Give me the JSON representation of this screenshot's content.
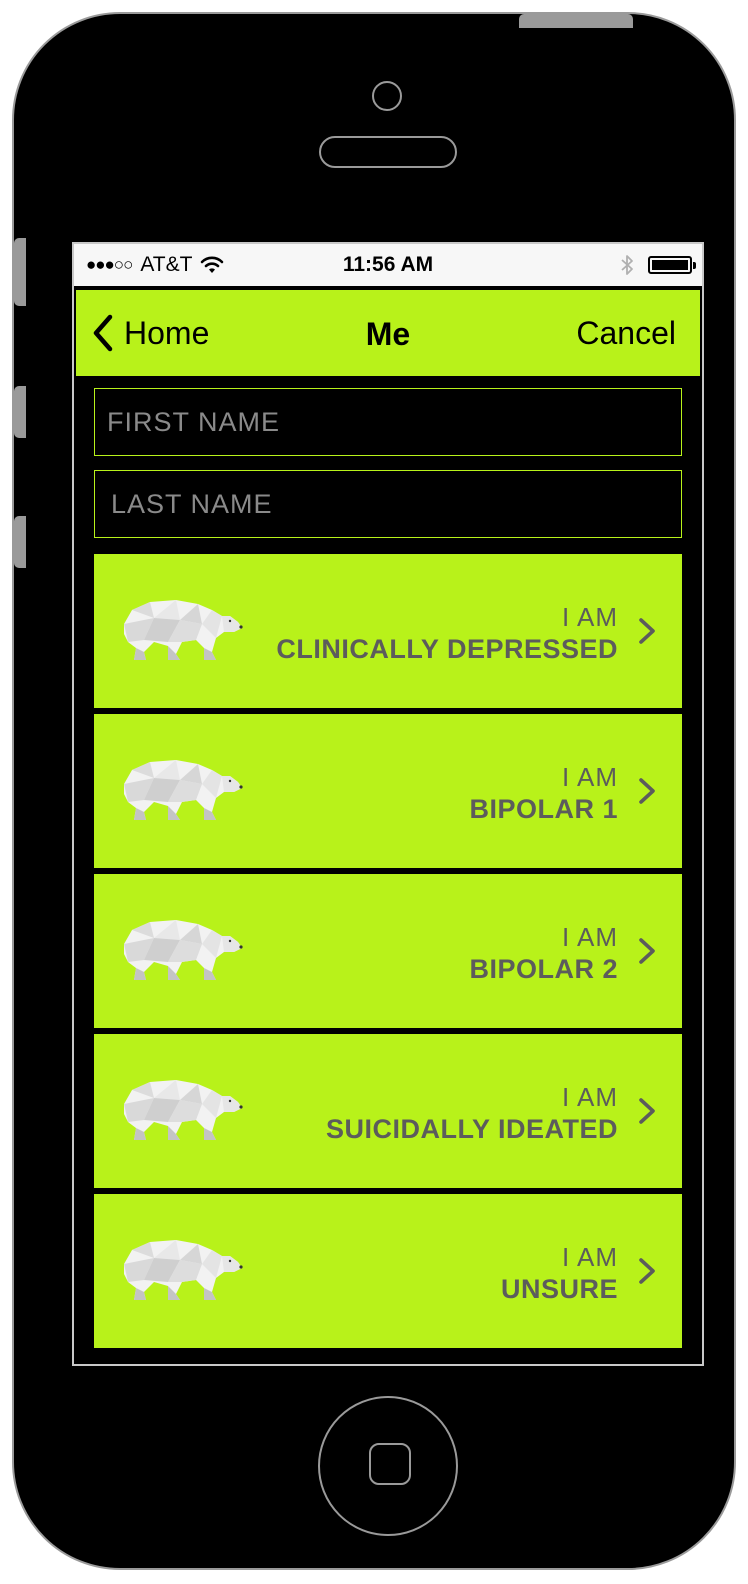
{
  "status_bar": {
    "signal": "●●●○○",
    "carrier": "AT&T",
    "time": "11:56 AM",
    "wifi_icon": "wifi-icon",
    "bluetooth_icon": "bluetooth-icon",
    "battery_icon": "battery-icon"
  },
  "nav": {
    "back_label": "Home",
    "title": "Me",
    "cancel_label": "Cancel"
  },
  "form": {
    "first_name_placeholder": "FIRST NAME",
    "last_name_placeholder": "LAST NAME"
  },
  "options": [
    {
      "prefix": "I AM",
      "label": "CLINICALLY DEPRESSED"
    },
    {
      "prefix": "I AM",
      "label": "BIPOLAR 1"
    },
    {
      "prefix": "I AM",
      "label": "BIPOLAR 2"
    },
    {
      "prefix": "I AM",
      "label": "SUICIDALLY IDEATED"
    },
    {
      "prefix": "I AM",
      "label": "UNSURE"
    }
  ],
  "colors": {
    "accent": "#b8f21a",
    "background": "#000000",
    "option_text": "#5c5c5c",
    "placeholder": "#8a8a8a"
  }
}
